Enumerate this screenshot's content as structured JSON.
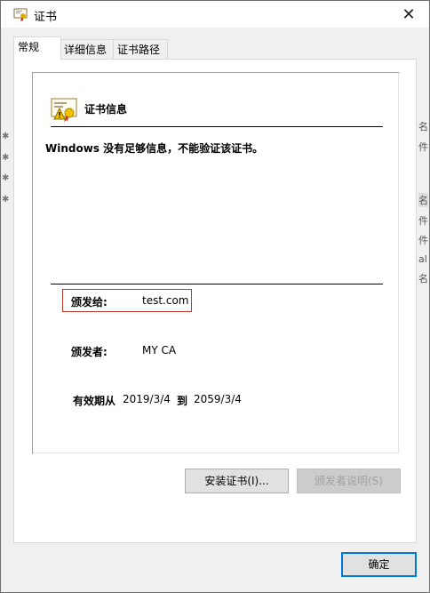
{
  "window": {
    "title": "证书",
    "close_glyph": "✕"
  },
  "tabs": [
    {
      "label": "常规",
      "active": true
    },
    {
      "label": "详细信息",
      "active": false
    },
    {
      "label": "证书路径",
      "active": false
    }
  ],
  "cert": {
    "section_title": "证书信息",
    "warning": "Windows 没有足够信息，不能验证该证书。",
    "issued_to_label": "颁发给:",
    "issued_to_value": "test.com",
    "issued_by_label": "颁发者:",
    "issued_by_value": "MY CA",
    "validity_label": "有效期从",
    "valid_from": "2019/3/4",
    "to_label": "到",
    "valid_to": "2059/3/4"
  },
  "buttons": {
    "install": "安装证书(I)...",
    "issuer_statement": "颁发者说明(S)",
    "ok": "确定"
  },
  "background_fragments": [
    "名",
    "件",
    "名",
    "件",
    "件",
    "al",
    "名"
  ],
  "icons": {
    "title": "certificate-icon",
    "cert": "certificate-warning-icon",
    "close": "close-icon"
  }
}
